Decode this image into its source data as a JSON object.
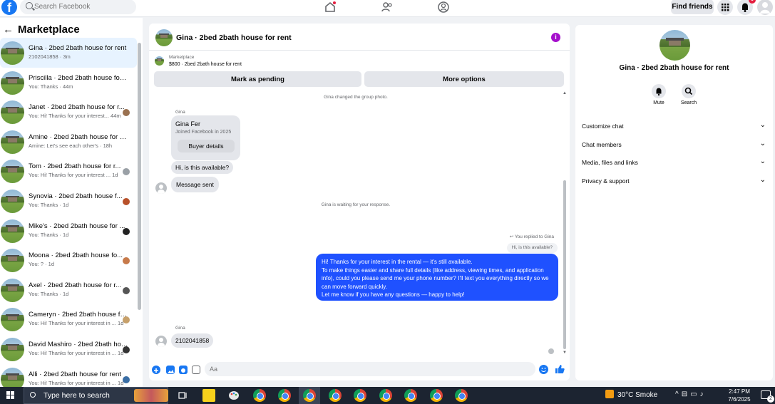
{
  "colors": {
    "brand": "#1877f2",
    "outgoing_bubble": "#1f51ff",
    "info": "#a50fcc",
    "badge": "#e41e3f"
  },
  "topbar": {
    "search_placeholder": "Search Facebook",
    "find_friends": "Find friends",
    "notif_badge": "6"
  },
  "sidebar": {
    "title": "Marketplace",
    "conversations": [
      {
        "title": "Gina · 2bed 2bath house for rent",
        "sub": "2102041858 · 3m"
      },
      {
        "title": "Priscilla · 2bed 2bath house for r...",
        "sub": "You: Thanks · 44m"
      },
      {
        "title": "Janet · 2bed 2bath house for r...",
        "sub": "You: Hi! Thanks for your interest...  44m"
      },
      {
        "title": "Amine · 2bed 2bath house for re...",
        "sub": "Amine: Let's see each other's · 18h"
      },
      {
        "title": "Tom · 2bed 2bath house for r...",
        "sub": "You: Hi! Thanks for your interest ...  1d"
      },
      {
        "title": "Synovia · 2bed 2bath house f...",
        "sub": "You: Thanks · 1d"
      },
      {
        "title": "Mike's · 2bed 2bath house for ...",
        "sub": "You: Thanks · 1d"
      },
      {
        "title": "Moona · 2bed 2bath house fo...",
        "sub": "You: ? · 1d"
      },
      {
        "title": "Axel · 2bed 2bath house for r...",
        "sub": "You: Thanks · 1d"
      },
      {
        "title": "Cameryn · 2bed 2bath house for...",
        "sub": "You: Hi! Thanks for your interest in ...  1d"
      },
      {
        "title": "David Mashiro · 2bed 2bath hou...",
        "sub": "You: Hi! Thanks for your interest in ...  1d"
      },
      {
        "title": "Alli · 2bed 2bath house for rent",
        "sub": "You: Hi! Thanks for your interest in ...  1d"
      }
    ]
  },
  "chat": {
    "title": "Gina · 2bed 2bath house for rent",
    "listing_label": "Marketplace",
    "listing_price": "$800 · 2bed 2bath house for rent",
    "mark_pending": "Mark as pending",
    "more_options": "More options",
    "sys_photo": "Gina changed the group photo.",
    "sender1": "Gina",
    "card_name": "Gina Fer",
    "card_joined": "Joined Facebook in 2025",
    "card_button": "Buyer details",
    "msg_available": "Hi, is this available?",
    "msg_sent": "Message sent",
    "sys_waiting": "Gina is waiting for your response.",
    "replied_to": "You replied to Gina",
    "quoted": "Hi, is this available?",
    "outgoing": "Hi! Thanks for your interest in the rental — it's still available.\nTo make things easier and share full details (like address, viewing times, and application info), could you please send me your phone number? I'll text you everything directly so we can move forward quickly.\nLet me know if you have any questions — happy to help!",
    "sender2": "Gina",
    "msg_phone": "2102041858",
    "composer_placeholder": "Aa"
  },
  "details": {
    "name": "Gina · 2bed 2bath house for rent",
    "mute": "Mute",
    "search": "Search",
    "rows": [
      "Customize chat",
      "Chat members",
      "Media, files and links",
      "Privacy & support"
    ]
  },
  "taskbar": {
    "search": "Type here to search",
    "weather": "30°C  Smoke",
    "time": "2:47 PM",
    "date": "7/6/2025",
    "notif_count": "2"
  }
}
